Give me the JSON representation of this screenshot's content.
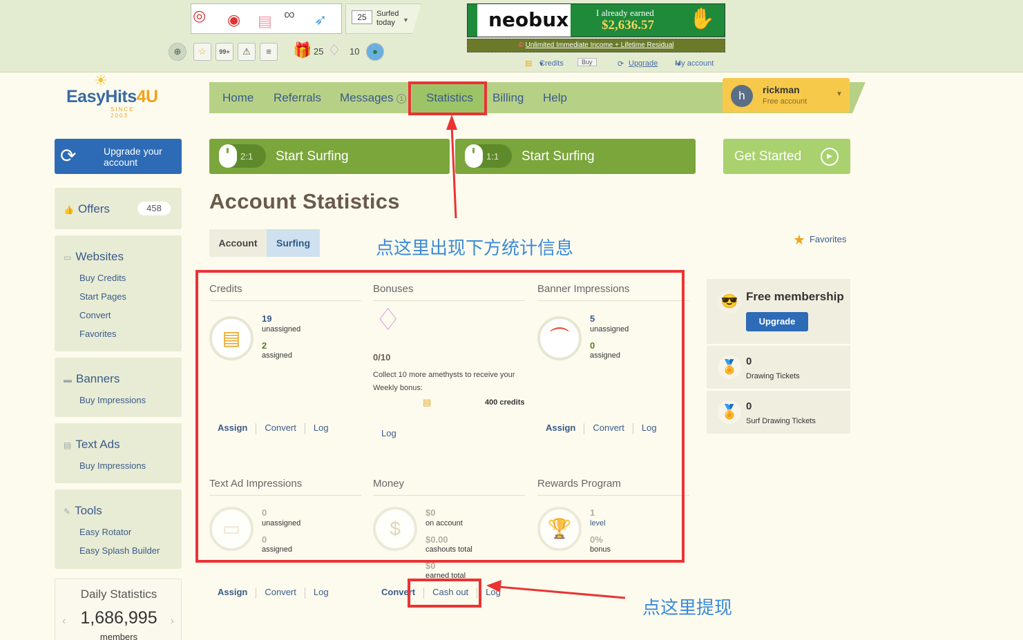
{
  "top": {
    "surfed_count": "25",
    "surfed_label_1": "Surfed",
    "surfed_label_2": "today",
    "messages_badge": "99+",
    "gifts_count": "25",
    "gems_count": "10",
    "ad": {
      "brand": "neobux",
      "earned_label": "I already earned",
      "earned_amount": "$2,636.57",
      "link_text": "Unlimited Immediate Income + Lifetime Residual"
    },
    "links": {
      "credits": "Credits",
      "buy": "Buy",
      "upgrade": "Upgrade",
      "my_account": "My account"
    }
  },
  "logo": {
    "easy": "EasyHits",
    "four": "4U",
    "since": "SINCE 2003"
  },
  "nav": {
    "items": [
      "Home",
      "Referrals",
      "Messages",
      "Statistics",
      "Billing",
      "Help"
    ],
    "messages_badge": "1",
    "active": "Statistics"
  },
  "user": {
    "initial": "h",
    "name": "rickman",
    "type": "Free account"
  },
  "sidebar": {
    "upgrade": "Upgrade your account",
    "offers": {
      "label": "Offers",
      "count": "458"
    },
    "websites": {
      "label": "Websites",
      "items": [
        "Buy Credits",
        "Start Pages",
        "Convert",
        "Favorites"
      ]
    },
    "banners": {
      "label": "Banners",
      "items": [
        "Buy Impressions"
      ]
    },
    "text_ads": {
      "label": "Text Ads",
      "items": [
        "Buy Impressions"
      ]
    },
    "tools": {
      "label": "Tools",
      "items": [
        "Easy Rotator",
        "Easy Splash Builder"
      ]
    },
    "daily": {
      "title": "Daily Statistics",
      "number": "1,686,995",
      "label": "members"
    }
  },
  "surf": {
    "btn1_ratio": "2:1",
    "btn1_label": "Start Surfing",
    "btn2_ratio": "1:1",
    "btn2_label": "Start Surfing",
    "get_started": "Get Started"
  },
  "page": {
    "title": "Account Statistics",
    "tabs": [
      "Account",
      "Surfing"
    ],
    "favorites": "Favorites"
  },
  "stats": {
    "credits": {
      "title": "Credits",
      "unassigned": "19",
      "unassigned_label": "unassigned",
      "assigned": "2",
      "assigned_label": "assigned",
      "actions": [
        "Assign",
        "Convert",
        "Log"
      ]
    },
    "bonuses": {
      "title": "Bonuses",
      "progress": "0/10",
      "desc": "Collect 10 more amethysts to receive your Weekly bonus:",
      "reward": "400 credits",
      "actions": [
        "Log"
      ]
    },
    "banner": {
      "title": "Banner Impressions",
      "unassigned": "5",
      "unassigned_label": "unassigned",
      "assigned": "0",
      "assigned_label": "assigned",
      "actions": [
        "Assign",
        "Convert",
        "Log"
      ]
    },
    "textad": {
      "title": "Text Ad Impressions",
      "unassigned": "0",
      "unassigned_label": "unassigned",
      "assigned": "0",
      "assigned_label": "assigned",
      "actions": [
        "Assign",
        "Convert",
        "Log"
      ]
    },
    "money": {
      "title": "Money",
      "on_account": "$0",
      "on_account_label": "on account",
      "cashouts": "$0.00",
      "cashouts_label": "cashouts total",
      "earned": "$0",
      "earned_label": "earned total",
      "actions": [
        "Convert",
        "Cash out",
        "Log"
      ]
    },
    "rewards": {
      "title": "Rewards Program",
      "level": "1",
      "level_label": "level",
      "bonus": "0%",
      "bonus_label": "bonus"
    }
  },
  "right": {
    "membership_title": "Free membership",
    "upgrade_btn": "Upgrade",
    "drawing_count": "0",
    "drawing_label": "Drawing Tickets",
    "surf_drawing_count": "0",
    "surf_drawing_label": "Surf Drawing Tickets"
  },
  "annotations": {
    "note_top": "点这里出现下方统计信息",
    "note_bottom": "点这里提现",
    "color": "#ea3333",
    "note_color": "#3b8ad8"
  }
}
